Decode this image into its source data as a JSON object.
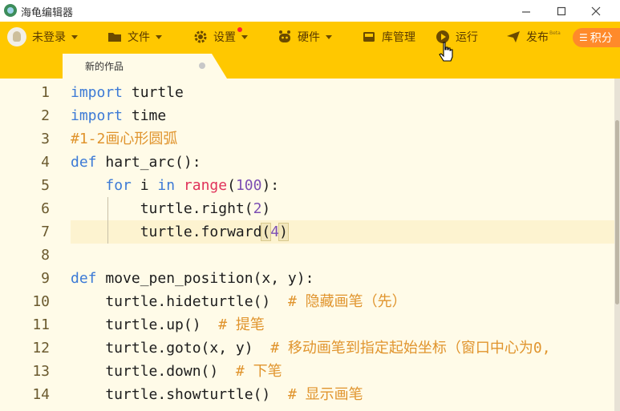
{
  "window": {
    "title": "海龟编辑器",
    "icons": [
      "app-logo-icon",
      "minimize-icon",
      "maximize-icon",
      "close-icon"
    ]
  },
  "toolbar": {
    "login": "未登录",
    "file": "文件",
    "settings": "设置",
    "hardware": "硬件",
    "library": "库管理",
    "run": "运行",
    "publish": "发布",
    "publish_badge": "Beta",
    "points": "积分",
    "brand_color": "#ffc800"
  },
  "tab": {
    "label": "新的作品"
  },
  "editor": {
    "lines": [
      {
        "num": "1",
        "tokens": [
          {
            "t": "import",
            "c": "k"
          },
          {
            "t": " turtle",
            "c": ""
          }
        ]
      },
      {
        "num": "2",
        "tokens": [
          {
            "t": "import",
            "c": "k"
          },
          {
            "t": " time",
            "c": ""
          }
        ]
      },
      {
        "num": "3",
        "tokens": [
          {
            "t": "#1-2画心形圆弧",
            "c": "c"
          }
        ]
      },
      {
        "num": "4",
        "tokens": [
          {
            "t": "def",
            "c": "k"
          },
          {
            "t": " hart_arc():",
            "c": ""
          }
        ]
      },
      {
        "num": "5",
        "tokens": [
          {
            "t": "    ",
            "c": ""
          },
          {
            "t": "for",
            "c": "k"
          },
          {
            "t": " i ",
            "c": ""
          },
          {
            "t": "in",
            "c": "k"
          },
          {
            "t": " ",
            "c": ""
          },
          {
            "t": "range",
            "c": "bi"
          },
          {
            "t": "(",
            "c": ""
          },
          {
            "t": "100",
            "c": "num"
          },
          {
            "t": "):",
            "c": ""
          }
        ]
      },
      {
        "num": "6",
        "tokens": [
          {
            "t": "        turtle.right(",
            "c": ""
          },
          {
            "t": "2",
            "c": "num"
          },
          {
            "t": ")",
            "c": ""
          }
        ]
      },
      {
        "num": "7",
        "tokens": [
          {
            "t": "        turtle.forward",
            "c": ""
          },
          {
            "t": "(",
            "c": "pm"
          },
          {
            "t": "4",
            "c": "num"
          },
          {
            "t": ")",
            "c": "pm"
          }
        ]
      },
      {
        "num": "8",
        "tokens": [
          {
            "t": "",
            "c": ""
          }
        ]
      },
      {
        "num": "9",
        "tokens": [
          {
            "t": "def",
            "c": "k"
          },
          {
            "t": " move_pen_position(x, y):",
            "c": ""
          }
        ]
      },
      {
        "num": "10",
        "tokens": [
          {
            "t": "    turtle.hideturtle()  ",
            "c": ""
          },
          {
            "t": "# 隐藏画笔（先）",
            "c": "c"
          }
        ]
      },
      {
        "num": "11",
        "tokens": [
          {
            "t": "    turtle.up()  ",
            "c": ""
          },
          {
            "t": "# 提笔",
            "c": "c"
          }
        ]
      },
      {
        "num": "12",
        "tokens": [
          {
            "t": "    turtle.goto(x, y)  ",
            "c": ""
          },
          {
            "t": "# 移动画笔到指定起始坐标（窗口中心为0,",
            "c": "c"
          }
        ]
      },
      {
        "num": "13",
        "tokens": [
          {
            "t": "    turtle.down()  ",
            "c": ""
          },
          {
            "t": "# 下笔",
            "c": "c"
          }
        ]
      },
      {
        "num": "14",
        "tokens": [
          {
            "t": "    turtle.showturtle()  ",
            "c": ""
          },
          {
            "t": "# 显示画笔",
            "c": "c"
          }
        ]
      }
    ]
  }
}
